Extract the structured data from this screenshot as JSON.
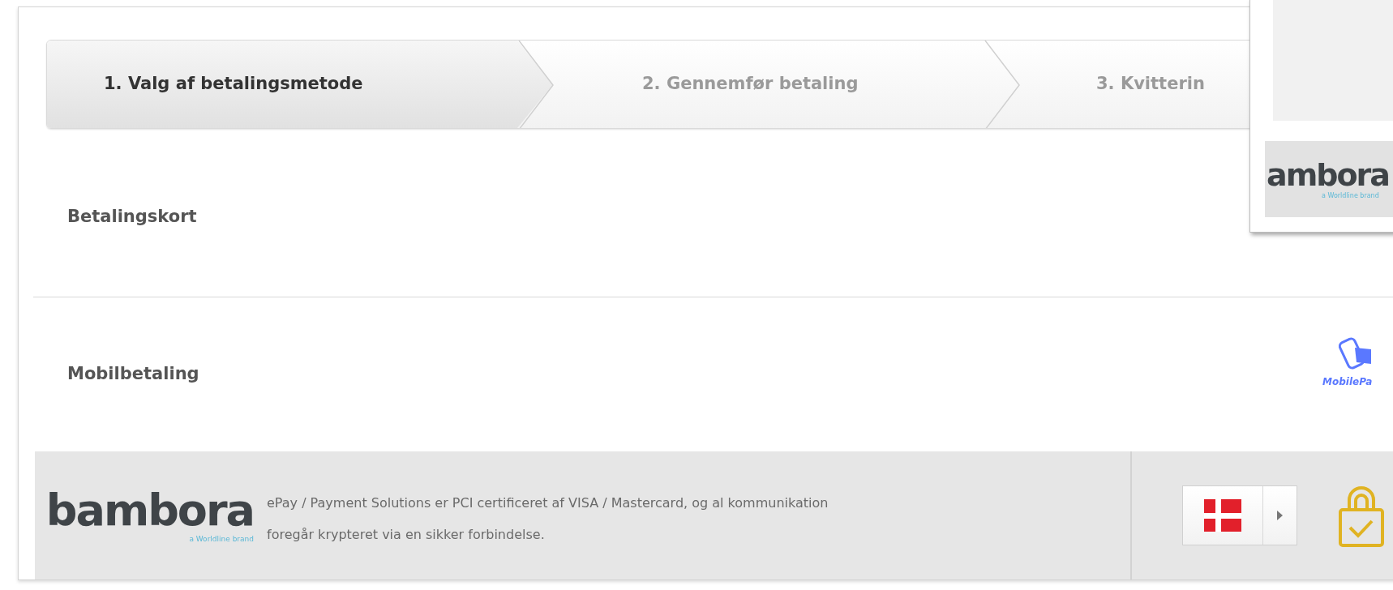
{
  "steps": [
    {
      "label": "1. Valg af betalingsmetode",
      "selected": true
    },
    {
      "label": "2. Gennemfør betaling",
      "selected": false
    },
    {
      "label": "3. Kvitterin",
      "selected": false
    }
  ],
  "methods": [
    {
      "label": "Betalingskort",
      "kind": "card"
    },
    {
      "label": "Mobilbetaling",
      "kind": "mobilepay",
      "logo_text": "MobilePa"
    }
  ],
  "footer": {
    "brand": "bambora",
    "tagline": "a Worldline brand",
    "notice_lines": [
      "ePay / Payment Solutions er PCI certificeret af VISA / Mastercard, og al kommunikation",
      "foregår krypteret via en sikker forbindelse."
    ]
  },
  "popup": {
    "brand": "ambora",
    "tagline": "a Worldline brand"
  }
}
